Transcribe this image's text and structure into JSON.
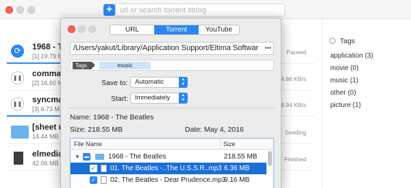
{
  "toolbar": {
    "add_label": "+",
    "search_placeholder": "url or search torrent string"
  },
  "torrents": [
    {
      "name": "1968 - The",
      "size": "[1] 19.79 M",
      "status": "Paused",
      "icon": "refresh-icon",
      "progress": 0.2
    },
    {
      "name": "command",
      "size": "[2] 16.60 M",
      "status": "74.86 KB/s",
      "icon": "pause-icon",
      "progress": 0.0
    },
    {
      "name": "syncmate",
      "size": "[3] 6.73 M",
      "status": "38.94 KB/s",
      "icon": "pause-icon",
      "progress": 0.3
    },
    {
      "name": "[sheet mu",
      "size": "14.44 MB",
      "status": "Seeding",
      "icon": "folder-icon",
      "progress": 0.0
    },
    {
      "name": "elmediap",
      "size": "42.06 MB",
      "status": "Finished",
      "icon": "file-icon",
      "progress": 0.0
    }
  ],
  "tags_panel": {
    "title": "Tags",
    "items": [
      {
        "label": "application (3)"
      },
      {
        "label": "movie (0)"
      },
      {
        "label": "music (1)"
      },
      {
        "label": "other (0)"
      },
      {
        "label": "picture (1)"
      }
    ]
  },
  "dialog": {
    "tabs": [
      {
        "label": "URL",
        "active": false
      },
      {
        "label": "Torrent",
        "active": true
      },
      {
        "label": "YouTube",
        "active": false
      }
    ],
    "path": "/Users/yakut/Library/Application Support/Eltima Softwar",
    "path_more": "•••",
    "tags_label": "Tags",
    "tag_value": "music",
    "save_to_label": "Save to:",
    "save_to_value": "Automatic",
    "start_label": "Start:",
    "start_value": "Immediately",
    "name_label": "Name:",
    "name_value": "1968 - The Beatles",
    "size_label": "Size:",
    "size_value": "218.55 MB",
    "date_label": "Date:",
    "date_value": "May 4, 2016",
    "files": {
      "col_name": "File Name",
      "col_size": "Size",
      "rows": [
        {
          "name": "1968 - The Beatles",
          "size": "218.55 MB",
          "type": "folder"
        },
        {
          "name": "01. The Beatles -..The U.S.S.R..mp3",
          "size": "6.36 MB",
          "type": "file",
          "selected": true
        },
        {
          "name": "02. The Beatles - Dear Prudence.mp3",
          "size": "9.16 MB",
          "type": "file",
          "selected": false
        }
      ]
    }
  },
  "colors": {
    "accent": "#2a86f0",
    "selection": "#1b6fd8",
    "close_red": "#fb5f57"
  }
}
